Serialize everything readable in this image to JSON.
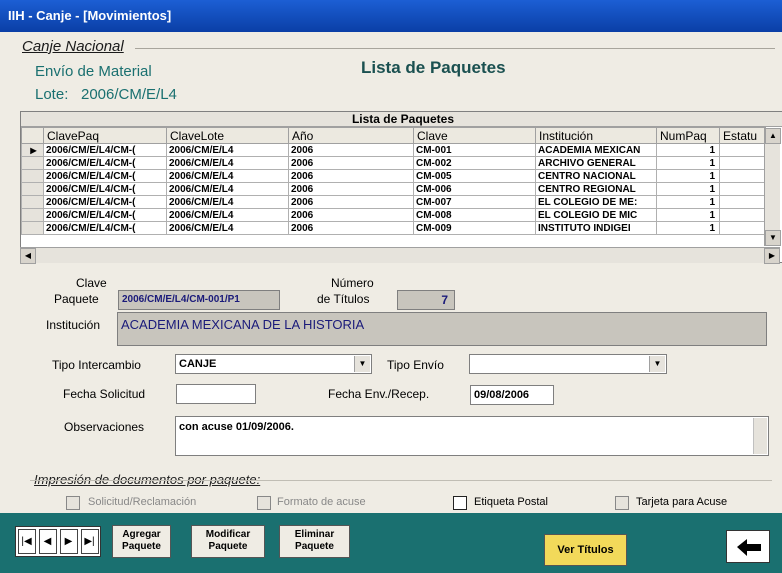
{
  "window": {
    "title": "IIH - Canje - [Movimientos]"
  },
  "header": {
    "section": "Canje Nacional",
    "subsection": "Envío de Material",
    "lote_label": "Lote:",
    "lote_value": "2006/CM/E/L4",
    "heading": "Lista de Paquetes"
  },
  "grid": {
    "caption": "Lista de Paquetes",
    "columns": [
      "ClavePaq",
      "ClaveLote",
      "Año",
      "Clave",
      "Institución",
      "NumPaq",
      "Estatu"
    ],
    "rows": [
      {
        "clavepaq": "2006/CM/E/L4/CM-(",
        "clavelote": "2006/CM/E/L4",
        "anio": "2006",
        "clave": "CM-001",
        "inst": "ACADEMIA MEXICAN",
        "numpaq": "1",
        "estatus": ""
      },
      {
        "clavepaq": "2006/CM/E/L4/CM-(",
        "clavelote": "2006/CM/E/L4",
        "anio": "2006",
        "clave": "CM-002",
        "inst": "ARCHIVO GENERAL",
        "numpaq": "1",
        "estatus": ""
      },
      {
        "clavepaq": "2006/CM/E/L4/CM-(",
        "clavelote": "2006/CM/E/L4",
        "anio": "2006",
        "clave": "CM-005",
        "inst": "CENTRO NACIONAL",
        "numpaq": "1",
        "estatus": ""
      },
      {
        "clavepaq": "2006/CM/E/L4/CM-(",
        "clavelote": "2006/CM/E/L4",
        "anio": "2006",
        "clave": "CM-006",
        "inst": "CENTRO REGIONAL",
        "numpaq": "1",
        "estatus": ""
      },
      {
        "clavepaq": "2006/CM/E/L4/CM-(",
        "clavelote": "2006/CM/E/L4",
        "anio": "2006",
        "clave": "CM-007",
        "inst": "EL COLEGIO DE ME:",
        "numpaq": "1",
        "estatus": ""
      },
      {
        "clavepaq": "2006/CM/E/L4/CM-(",
        "clavelote": "2006/CM/E/L4",
        "anio": "2006",
        "clave": "CM-008",
        "inst": "EL COLEGIO DE MIC",
        "numpaq": "1",
        "estatus": ""
      },
      {
        "clavepaq": "2006/CM/E/L4/CM-(",
        "clavelote": "2006/CM/E/L4",
        "anio": "2006",
        "clave": "CM-009",
        "inst": "INSTITUTO INDIGEI",
        "numpaq": "1",
        "estatus": ""
      }
    ],
    "selected_marker": "▶"
  },
  "detail": {
    "clave_label_1": "Clave",
    "clave_label_2": "Paquete",
    "clave_value": "2006/CM/E/L4/CM-001/P1",
    "numero_label_1": "Número",
    "numero_label_2": "de Títulos",
    "numero_value": "7",
    "institucion_label": "Institución",
    "institucion_value": "ACADEMIA MEXICANA DE LA HISTORIA",
    "tipo_intercambio_label": "Tipo Intercambio",
    "tipo_intercambio_value": "CANJE",
    "tipo_envio_label": "Tipo Envío",
    "tipo_envio_value": "",
    "fecha_solicitud_label": "Fecha Solicitud",
    "fecha_solicitud_value": "",
    "fecha_env_label": "Fecha Env./Recep.",
    "fecha_env_value": "09/08/2006",
    "observaciones_label": "Observaciones",
    "observaciones_value": "con acuse 01/09/2006."
  },
  "print": {
    "title": "Impresión de documentos por paquete:",
    "solicitud": "Solicitud/Reclamación",
    "formato": "Formato de acuse",
    "etiqueta": "Etiqueta Postal",
    "tarjeta": "Tarjeta para Acuse"
  },
  "toolbar": {
    "nav_first": "|◀",
    "nav_prev": "◀",
    "nav_next": "▶",
    "nav_last": "▶|",
    "agregar_1": "Agregar",
    "agregar_2": "Paquete",
    "modificar_1": "Modificar",
    "modificar_2": "Paquete",
    "eliminar_1": "Eliminar",
    "eliminar_2": "Paquete",
    "ver_titulos": "Ver Títulos",
    "back_icon": "back-arrow-icon"
  },
  "colors": {
    "titlebar": "#0a3fa6",
    "toolbar": "#1a7070",
    "highlight_button": "#f2d95a"
  }
}
